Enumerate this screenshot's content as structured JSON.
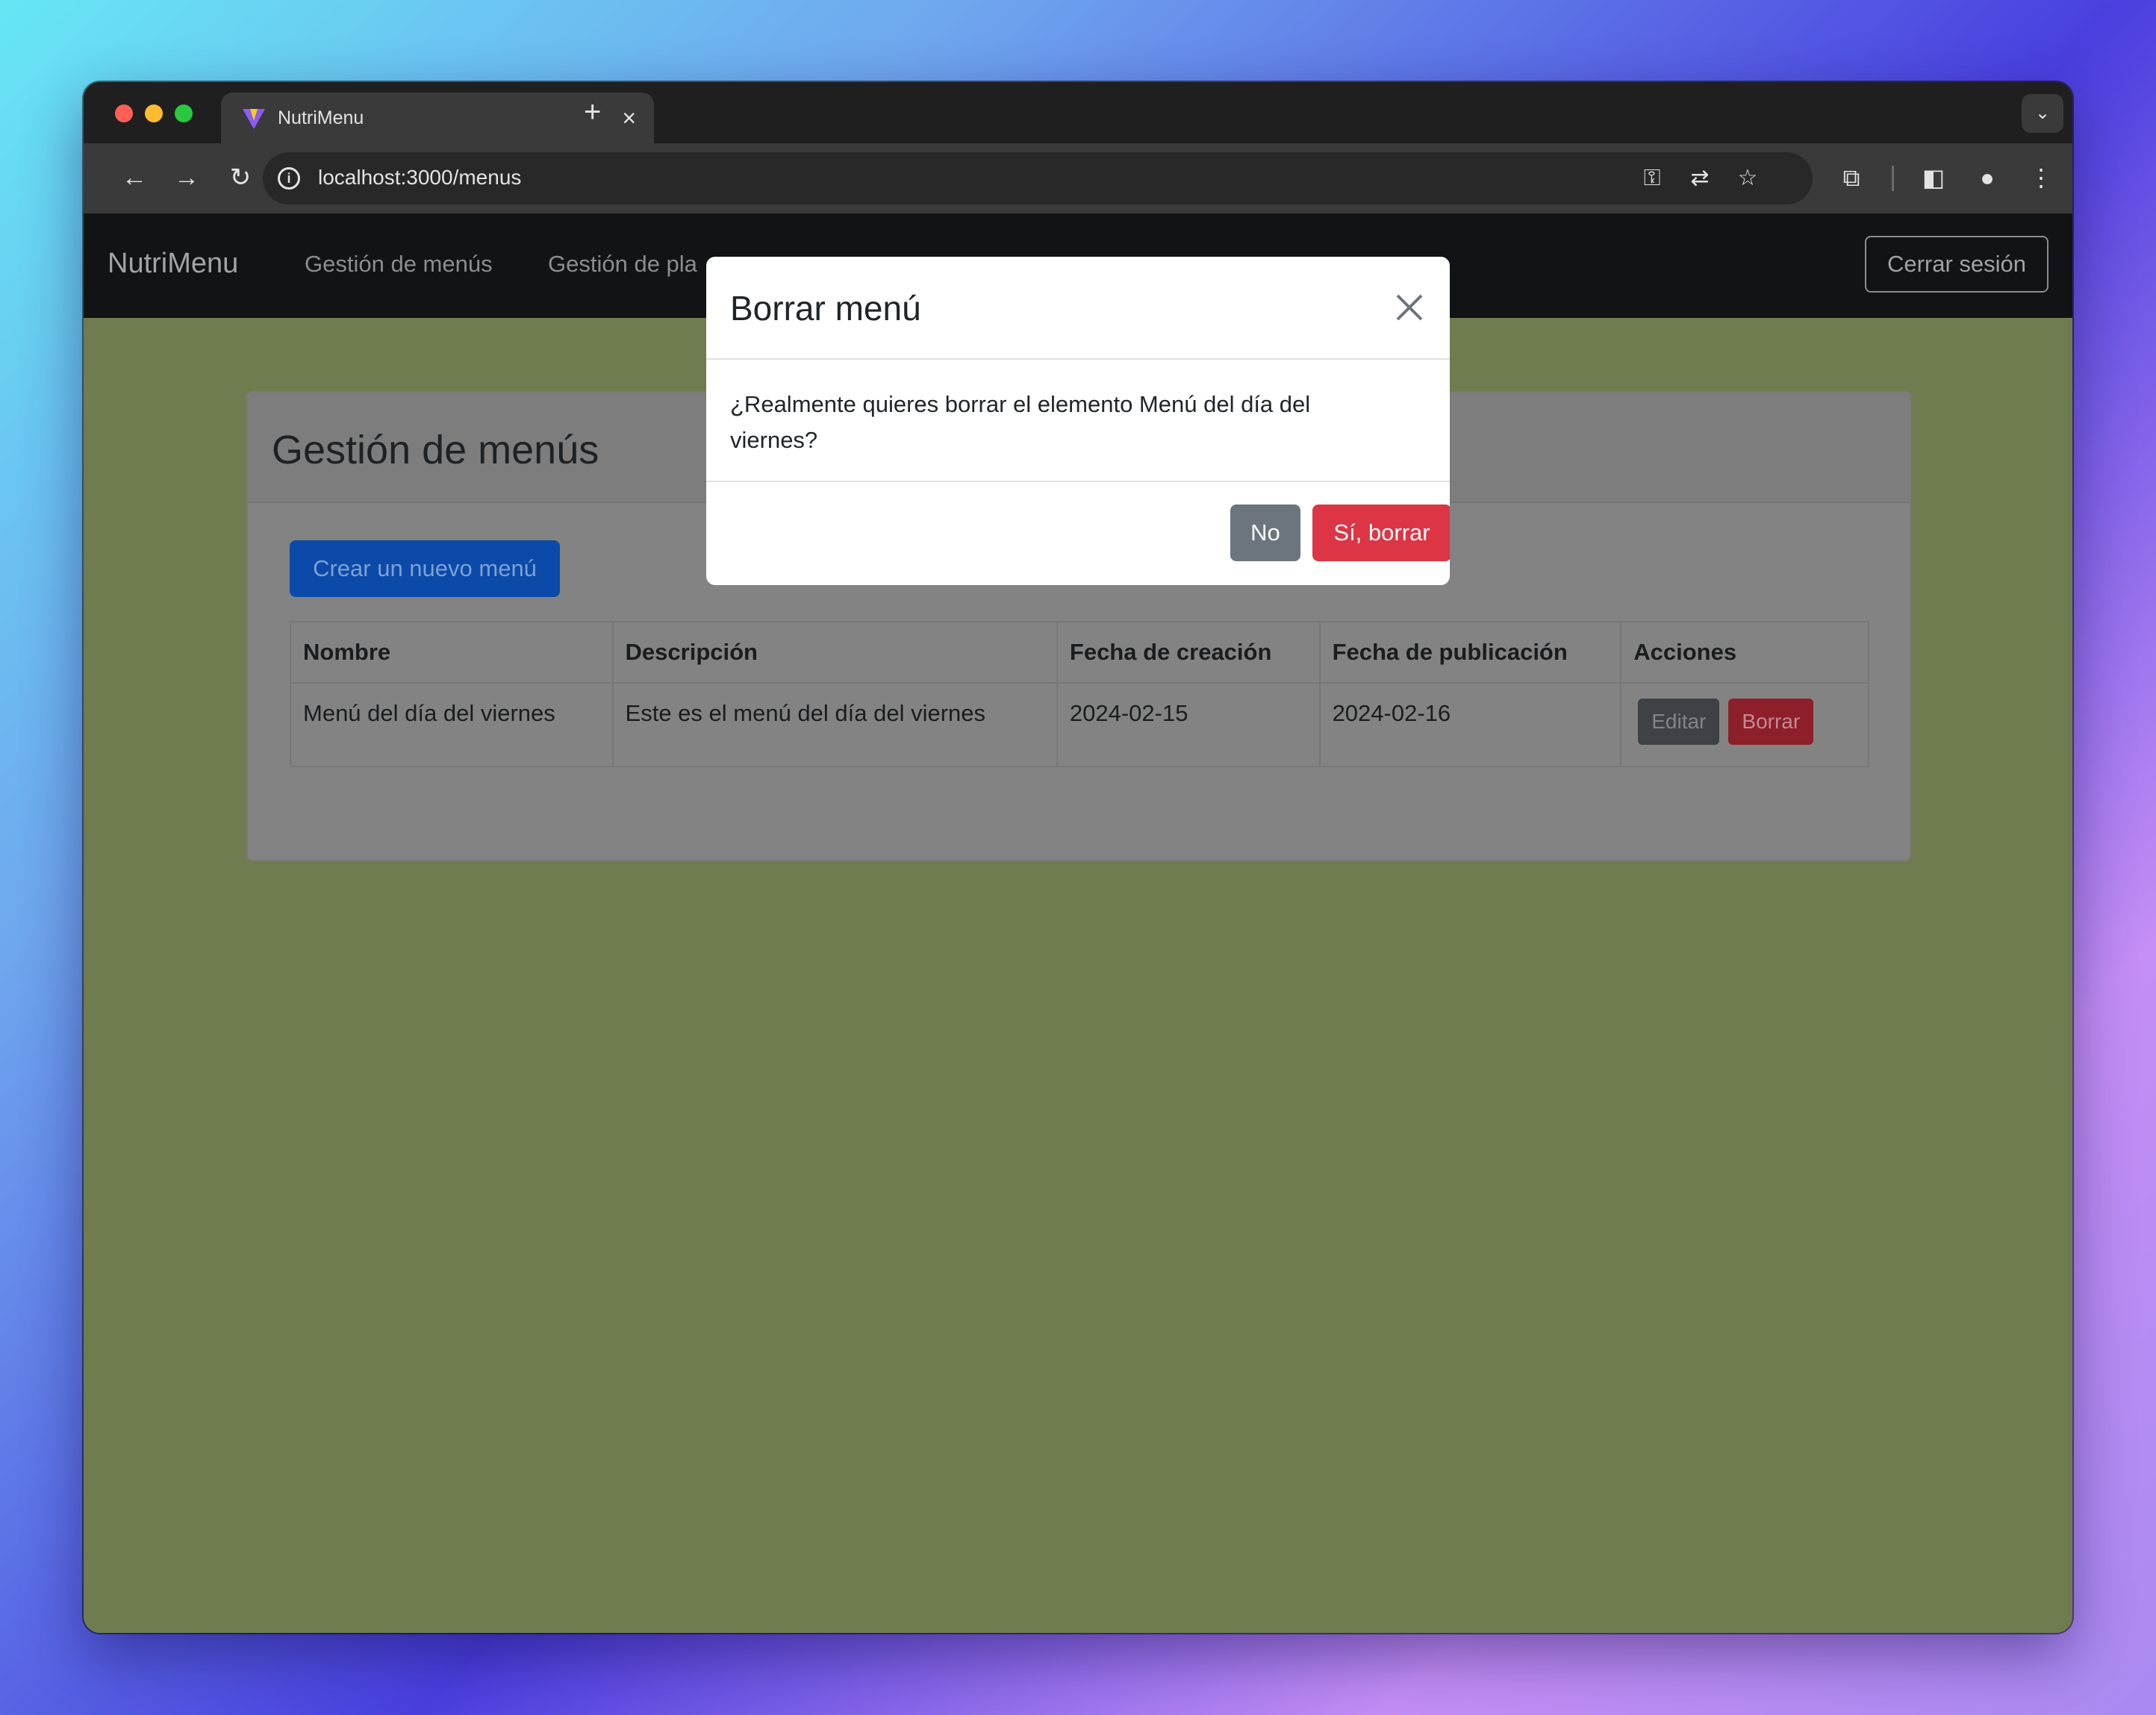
{
  "browser": {
    "tab_title": "NutriMenu",
    "tab_close": "×",
    "new_tab": "+",
    "url": "localhost:3000/menus",
    "icons": [
      "back-icon",
      "forward-icon",
      "reload-icon",
      "site-info-icon",
      "password-key-icon",
      "translate-icon",
      "bookmark-star-icon",
      "extensions-icon",
      "side-panel-icon",
      "profile-icon",
      "more-menu-icon"
    ]
  },
  "navbar": {
    "brand": "NutriMenu",
    "links": [
      "Gestión de menús",
      "Gestión de pla"
    ],
    "logout": "Cerrar sesión"
  },
  "page": {
    "title": "Gestión de menús",
    "create_button": "Crear un nuevo menú",
    "table": {
      "headers": [
        "Nombre",
        "Descripción",
        "Fecha de creación",
        "Fecha de publicación",
        "Acciones"
      ],
      "rows": [
        {
          "nombre": "Menú del día del viernes",
          "descripcion": "Este es el menú del día del viernes",
          "fecha_creacion": "2024-02-15",
          "fecha_publicacion": "2024-02-16",
          "edit": "Editar",
          "delete": "Borrar"
        }
      ]
    }
  },
  "modal": {
    "title": "Borrar menú",
    "message": "¿Realmente quieres borrar el elemento Menú del día del viernes?",
    "no": "No",
    "yes": "Sí, borrar"
  },
  "colors": {
    "primary": "#0d6efd",
    "danger": "#dc3545",
    "secondary": "#6c757d",
    "navbar": "#212529"
  }
}
